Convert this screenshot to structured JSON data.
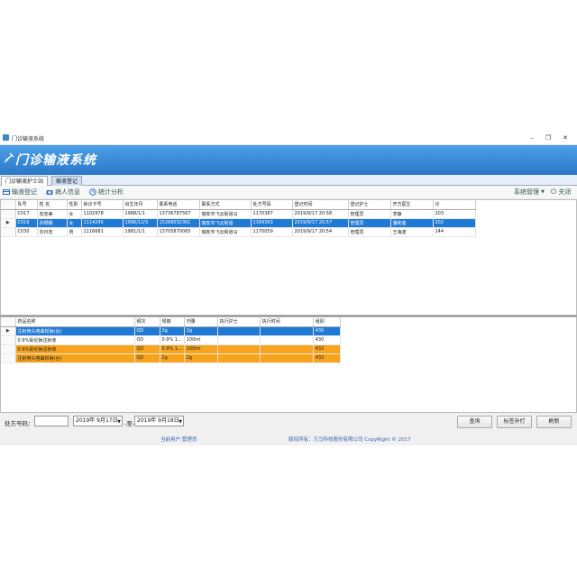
{
  "window": {
    "title": "门诊输液系统"
  },
  "banner": {
    "title": "门诊输液系统"
  },
  "tabs": [
    {
      "label": "门诊输液护士站"
    },
    {
      "label": "输液登记"
    }
  ],
  "toolbar": {
    "items": [
      {
        "label": "输液登记",
        "icon": "infusion-icon"
      },
      {
        "label": "病人信息",
        "icon": "camera-icon"
      },
      {
        "label": "统计分析",
        "icon": "clock-icon"
      }
    ],
    "system_menu": "系统管理",
    "close_label": "关闭"
  },
  "patients": {
    "columns": [
      "队号",
      "姓 名",
      "性别",
      "就诊卡号",
      "出生年月",
      "联系电话",
      "联系方式",
      "处方号码",
      "登记时间",
      "登记护士",
      "开方医生",
      "诊"
    ],
    "rows": [
      [
        "C017",
        "向忠美",
        "女",
        "1102978",
        "1988/1/1",
        "13736787567",
        "瑞安市飞云街道马",
        "1170387",
        "2019/9/17 20:58",
        "管理员",
        "李静",
        "203"
      ],
      [
        "C016",
        "孙卿娜",
        "女",
        "1114245",
        "1996/12/3",
        "15268032361",
        "瑞安市飞云街道",
        "1169393",
        "2019/9/17 20:57",
        "管理员",
        "潘莉莲",
        "202"
      ],
      [
        "C030",
        "刘日忠",
        "男",
        "1116681",
        "1981/1/1",
        "13705870065",
        "瑞安市飞云街道马",
        "1170059",
        "2019/9/17 20:54",
        "管理员",
        "王海波",
        "144"
      ]
    ]
  },
  "drugs": {
    "columns": [
      "药品名称",
      "频次",
      "规格",
      "剂量",
      "执行护士",
      "执行时间",
      "组别"
    ],
    "rows": [
      [
        "注射用头孢曲松钠(台)",
        "QD",
        "2g",
        "2g",
        "",
        "",
        "430"
      ],
      [
        "0.9%氯化钠注射液",
        "QD",
        "0.9% 1...",
        "100ml",
        "",
        "",
        "430"
      ],
      [
        "0.9%氯化钠注射液",
        "QD",
        "0.9% 1...",
        "100ml",
        "",
        "",
        "432"
      ],
      [
        "注射用头孢曲松钠(台)",
        "QD",
        "2g",
        "2g",
        "",
        "",
        "432"
      ]
    ]
  },
  "filter": {
    "prescription_label": "处方号码：",
    "prescription_value": "",
    "date_from": "2019年 9月17日",
    "to_label": "-至-",
    "date_to": "2019年 9月18日",
    "query_label": "查询",
    "label_print_label": "标签补打",
    "refresh_label": "刷新"
  },
  "status": {
    "current_user": "当前用户:管理员",
    "copyright": "版权所有：万马科技股份有限公司 CopyRight © 2017"
  }
}
